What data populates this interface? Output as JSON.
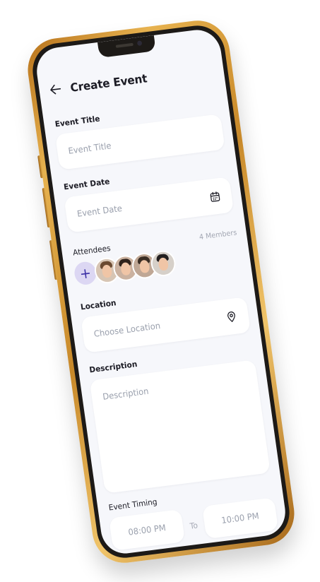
{
  "header": {
    "title": "Create Event"
  },
  "event_title": {
    "label": "Event Title",
    "placeholder": "Event Title"
  },
  "event_date": {
    "label": "Event Date",
    "placeholder": "Event Date"
  },
  "attendees": {
    "label": "Attendees",
    "members": "4 Members",
    "add_label": "+",
    "avatars": [
      {
        "hair": "#6b4a31",
        "bg": "#d7c5b4"
      },
      {
        "hair": "#2f221b",
        "bg": "#cbb2a0"
      },
      {
        "hair": "#3a2d24",
        "bg": "#bfa795"
      },
      {
        "hair": "#242020",
        "bg": "#d6d0c9"
      }
    ]
  },
  "location": {
    "label": "Location",
    "placeholder": "Choose Location"
  },
  "description": {
    "label": "Description",
    "placeholder": "Description"
  },
  "timing": {
    "label": "Event Timing",
    "start": "08:00 PM",
    "to": "To",
    "end": "10:00 PM"
  },
  "colors": {
    "accent": "#3c30a6",
    "accent_bg": "#dcd7f3",
    "screen_bg": "#f6f7fb",
    "frame": "#e7b24f"
  }
}
